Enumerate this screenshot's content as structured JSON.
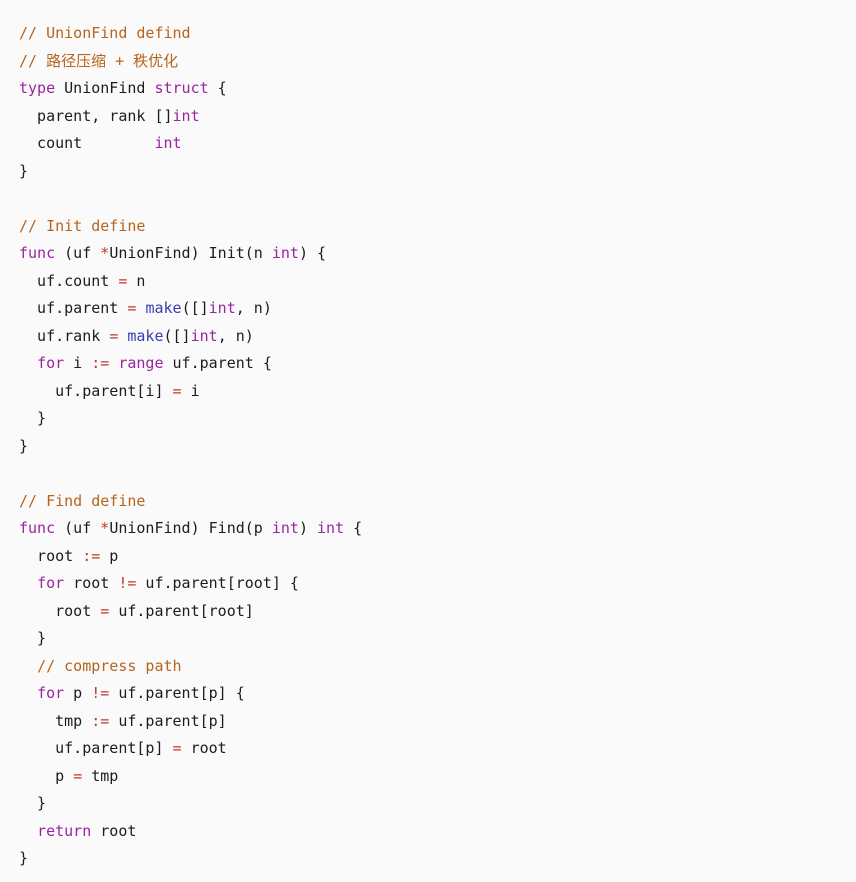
{
  "editor": {
    "language": "go",
    "background_color": "#fafafa",
    "foreground_color": "#1c1c1c",
    "font_size_px": 15,
    "line_height_px": 27.5
  },
  "theme": {
    "comment_color": "#b5651d",
    "keyword_color": "#9b24a0",
    "type_color": "#9b24a0",
    "builtin_color": "#3b3bb0",
    "operator_color": "#c0392b",
    "plain_color": "#1c1c1c"
  },
  "code": {
    "full_text": "// UnionFind defind\n// 路径压缩 + 秩优化\ntype UnionFind struct {\n  parent, rank []int\n  count        int\n}\n\n// Init define\nfunc (uf *UnionFind) Init(n int) {\n  uf.count = n\n  uf.parent = make([]int, n)\n  uf.rank = make([]int, n)\n  for i := range uf.parent {\n    uf.parent[i] = i\n  }\n}\n\n// Find define\nfunc (uf *UnionFind) Find(p int) int {\n  root := p\n  for root != uf.parent[root] {\n    root = uf.parent[root]\n  }\n  // compress path\n  for p != uf.parent[p] {\n    tmp := uf.parent[p]\n    uf.parent[p] = root\n    p = tmp\n  }\n  return root\n}",
    "lines": [
      {
        "text": "// UnionFind defind",
        "tokens": [
          {
            "t": "// UnionFind defind",
            "c": "comment"
          }
        ]
      },
      {
        "text": "// 路径压缩 + 秩优化",
        "tokens": [
          {
            "t": "// 路径压缩 + 秩优化",
            "c": "comment"
          }
        ]
      },
      {
        "text": "type UnionFind struct {",
        "tokens": [
          {
            "t": "type",
            "c": "keyword"
          },
          {
            "t": " UnionFind ",
            "c": "plain"
          },
          {
            "t": "struct",
            "c": "keyword"
          },
          {
            "t": " {",
            "c": "plain"
          }
        ]
      },
      {
        "text": "  parent, rank []int",
        "tokens": [
          {
            "t": "  parent, rank []",
            "c": "plain"
          },
          {
            "t": "int",
            "c": "type"
          }
        ]
      },
      {
        "text": "  count        int",
        "tokens": [
          {
            "t": "  count        ",
            "c": "plain"
          },
          {
            "t": "int",
            "c": "type"
          }
        ]
      },
      {
        "text": "}",
        "tokens": [
          {
            "t": "}",
            "c": "plain"
          }
        ]
      },
      {
        "text": "",
        "tokens": []
      },
      {
        "text": "// Init define",
        "tokens": [
          {
            "t": "// Init define",
            "c": "comment"
          }
        ]
      },
      {
        "text": "func (uf *UnionFind) Init(n int) {",
        "tokens": [
          {
            "t": "func",
            "c": "keyword"
          },
          {
            "t": " (uf ",
            "c": "plain"
          },
          {
            "t": "*",
            "c": "operator"
          },
          {
            "t": "UnionFind) Init(n ",
            "c": "plain"
          },
          {
            "t": "int",
            "c": "type"
          },
          {
            "t": ") {",
            "c": "plain"
          }
        ]
      },
      {
        "text": "  uf.count = n",
        "tokens": [
          {
            "t": "  uf.count ",
            "c": "plain"
          },
          {
            "t": "=",
            "c": "operator"
          },
          {
            "t": " n",
            "c": "plain"
          }
        ]
      },
      {
        "text": "  uf.parent = make([]int, n)",
        "tokens": [
          {
            "t": "  uf.parent ",
            "c": "plain"
          },
          {
            "t": "=",
            "c": "operator"
          },
          {
            "t": " ",
            "c": "plain"
          },
          {
            "t": "make",
            "c": "builtin"
          },
          {
            "t": "([]",
            "c": "plain"
          },
          {
            "t": "int",
            "c": "type"
          },
          {
            "t": ", n)",
            "c": "plain"
          }
        ]
      },
      {
        "text": "  uf.rank = make([]int, n)",
        "tokens": [
          {
            "t": "  uf.rank ",
            "c": "plain"
          },
          {
            "t": "=",
            "c": "operator"
          },
          {
            "t": " ",
            "c": "plain"
          },
          {
            "t": "make",
            "c": "builtin"
          },
          {
            "t": "([]",
            "c": "plain"
          },
          {
            "t": "int",
            "c": "type"
          },
          {
            "t": ", n)",
            "c": "plain"
          }
        ]
      },
      {
        "text": "  for i := range uf.parent {",
        "tokens": [
          {
            "t": "  ",
            "c": "plain"
          },
          {
            "t": "for",
            "c": "keyword"
          },
          {
            "t": " i ",
            "c": "plain"
          },
          {
            "t": ":=",
            "c": "operator"
          },
          {
            "t": " ",
            "c": "plain"
          },
          {
            "t": "range",
            "c": "keyword"
          },
          {
            "t": " uf.parent {",
            "c": "plain"
          }
        ]
      },
      {
        "text": "    uf.parent[i] = i",
        "tokens": [
          {
            "t": "    uf.parent[i] ",
            "c": "plain"
          },
          {
            "t": "=",
            "c": "operator"
          },
          {
            "t": " i",
            "c": "plain"
          }
        ]
      },
      {
        "text": "  }",
        "tokens": [
          {
            "t": "  }",
            "c": "plain"
          }
        ]
      },
      {
        "text": "}",
        "tokens": [
          {
            "t": "}",
            "c": "plain"
          }
        ]
      },
      {
        "text": "",
        "tokens": []
      },
      {
        "text": "// Find define",
        "tokens": [
          {
            "t": "// Find define",
            "c": "comment"
          }
        ]
      },
      {
        "text": "func (uf *UnionFind) Find(p int) int {",
        "tokens": [
          {
            "t": "func",
            "c": "keyword"
          },
          {
            "t": " (uf ",
            "c": "plain"
          },
          {
            "t": "*",
            "c": "operator"
          },
          {
            "t": "UnionFind) Find(p ",
            "c": "plain"
          },
          {
            "t": "int",
            "c": "type"
          },
          {
            "t": ") ",
            "c": "plain"
          },
          {
            "t": "int",
            "c": "type"
          },
          {
            "t": " {",
            "c": "plain"
          }
        ]
      },
      {
        "text": "  root := p",
        "tokens": [
          {
            "t": "  root ",
            "c": "plain"
          },
          {
            "t": ":=",
            "c": "operator"
          },
          {
            "t": " p",
            "c": "plain"
          }
        ]
      },
      {
        "text": "  for root != uf.parent[root] {",
        "tokens": [
          {
            "t": "  ",
            "c": "plain"
          },
          {
            "t": "for",
            "c": "keyword"
          },
          {
            "t": " root ",
            "c": "plain"
          },
          {
            "t": "!=",
            "c": "operator"
          },
          {
            "t": " uf.parent[root] {",
            "c": "plain"
          }
        ]
      },
      {
        "text": "    root = uf.parent[root]",
        "tokens": [
          {
            "t": "    root ",
            "c": "plain"
          },
          {
            "t": "=",
            "c": "operator"
          },
          {
            "t": " uf.parent[root]",
            "c": "plain"
          }
        ]
      },
      {
        "text": "  }",
        "tokens": [
          {
            "t": "  }",
            "c": "plain"
          }
        ]
      },
      {
        "text": "  // compress path",
        "tokens": [
          {
            "t": "  ",
            "c": "plain"
          },
          {
            "t": "// compress path",
            "c": "comment"
          }
        ]
      },
      {
        "text": "  for p != uf.parent[p] {",
        "tokens": [
          {
            "t": "  ",
            "c": "plain"
          },
          {
            "t": "for",
            "c": "keyword"
          },
          {
            "t": " p ",
            "c": "plain"
          },
          {
            "t": "!=",
            "c": "operator"
          },
          {
            "t": " uf.parent[p] {",
            "c": "plain"
          }
        ]
      },
      {
        "text": "    tmp := uf.parent[p]",
        "tokens": [
          {
            "t": "    tmp ",
            "c": "plain"
          },
          {
            "t": ":=",
            "c": "operator"
          },
          {
            "t": " uf.parent[p]",
            "c": "plain"
          }
        ]
      },
      {
        "text": "    uf.parent[p] = root",
        "tokens": [
          {
            "t": "    uf.parent[p] ",
            "c": "plain"
          },
          {
            "t": "=",
            "c": "operator"
          },
          {
            "t": " root",
            "c": "plain"
          }
        ]
      },
      {
        "text": "    p = tmp",
        "tokens": [
          {
            "t": "    p ",
            "c": "plain"
          },
          {
            "t": "=",
            "c": "operator"
          },
          {
            "t": " tmp",
            "c": "plain"
          }
        ]
      },
      {
        "text": "  }",
        "tokens": [
          {
            "t": "  }",
            "c": "plain"
          }
        ]
      },
      {
        "text": "  return root",
        "tokens": [
          {
            "t": "  ",
            "c": "plain"
          },
          {
            "t": "return",
            "c": "keyword"
          },
          {
            "t": " root",
            "c": "plain"
          }
        ]
      },
      {
        "text": "}",
        "tokens": [
          {
            "t": "}",
            "c": "plain"
          }
        ]
      }
    ]
  }
}
